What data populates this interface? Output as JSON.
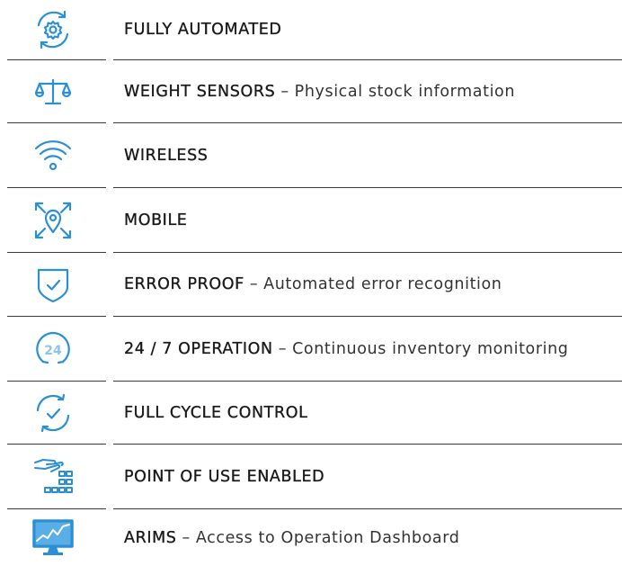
{
  "colors": {
    "accent": "#2b8fd6",
    "text": "#1a1a1a",
    "rule": "#3a3a3a"
  },
  "features": [
    {
      "icon": "gear-cycle-icon",
      "title": "FULLY AUTOMATED",
      "separator": "",
      "desc": ""
    },
    {
      "icon": "scale-icon",
      "title": "WEIGHT SENSORS",
      "separator": "–",
      "desc": "Physical stock information"
    },
    {
      "icon": "wifi-icon",
      "title": "WIRELESS",
      "separator": "",
      "desc": ""
    },
    {
      "icon": "location-expand-icon",
      "title": "MOBILE",
      "separator": "",
      "desc": ""
    },
    {
      "icon": "shield-check-icon",
      "title": "ERROR PROOF",
      "separator": "–",
      "desc": "Automated error recognition"
    },
    {
      "icon": "clock-24-icon",
      "icon_text": "24",
      "title": "24 / 7 OPERATION",
      "separator": "–",
      "desc": "Continuous inventory monitoring"
    },
    {
      "icon": "cycle-check-icon",
      "title": "FULL CYCLE CONTROL",
      "separator": "",
      "desc": ""
    },
    {
      "icon": "hand-grid-icon",
      "title": "POINT OF USE ENABLED",
      "separator": "",
      "desc": ""
    },
    {
      "icon": "monitor-chart-icon",
      "title": "ARIMS",
      "separator": "–",
      "desc": "Access to Operation Dashboard"
    }
  ]
}
